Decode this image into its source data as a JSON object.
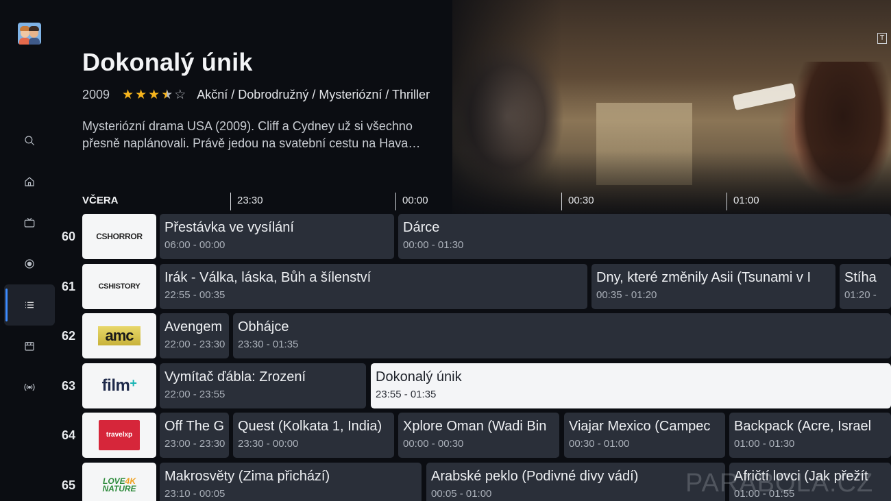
{
  "hero": {
    "title": "Dokonalý únik",
    "year": "2009",
    "rating": 3.5,
    "genres": "Akční / Dobrodružný / Mysteriózní / Thriller",
    "desc_line1": "Mysteriózní drama USA (2009). Cliff a Cydney už si všechno",
    "desc_line2": "přesně naplánovali. Právě jedou na svatební cestu na Hava…",
    "corner_badge": "T"
  },
  "sidebar": {
    "items": [
      {
        "icon": "search-icon"
      },
      {
        "icon": "home-icon"
      },
      {
        "icon": "tv-icon"
      },
      {
        "icon": "record-icon"
      },
      {
        "icon": "list-icon",
        "active": true
      },
      {
        "icon": "film-icon"
      },
      {
        "icon": "broadcast-icon"
      }
    ]
  },
  "timeline": {
    "day": "VČERA",
    "marks": [
      "23:30",
      "00:00",
      "00:30",
      "01:00"
    ]
  },
  "channels": [
    {
      "number": "60",
      "logo": "CSHORROR",
      "programs": [
        {
          "title": "Přestávka ve vysílání",
          "time": "06:00 - 00:00"
        },
        {
          "title": "Dárce",
          "time": "00:00 - 01:30"
        }
      ]
    },
    {
      "number": "61",
      "logo": "CSHISTORY",
      "programs": [
        {
          "title": "Irák - Válka, láska, Bůh a šílenství",
          "time": "22:55 - 00:35"
        },
        {
          "title": "Dny, které změnily Asii (Tsunami v I",
          "time": "00:35 - 01:20"
        },
        {
          "title": "Stíha",
          "time": "01:20 -"
        }
      ]
    },
    {
      "number": "62",
      "logo": "amc",
      "programs": [
        {
          "title": "Avengem",
          "time": "22:00 - 23:30"
        },
        {
          "title": "Obhájce",
          "time": "23:30 - 01:35"
        }
      ]
    },
    {
      "number": "63",
      "logo": "film",
      "programs": [
        {
          "title": "Vymítač ďábla: Zrození",
          "time": "22:00 - 23:55"
        },
        {
          "title": "Dokonalý únik",
          "time": "23:55 - 01:35",
          "selected": true
        }
      ]
    },
    {
      "number": "64",
      "logo": "travelxp",
      "programs": [
        {
          "title": "Off The G",
          "time": "23:00 - 23:30"
        },
        {
          "title": "Quest (Kolkata 1, India)",
          "time": "23:30 - 00:00"
        },
        {
          "title": "Xplore Oman (Wadi Bin",
          "time": "00:00 - 00:30"
        },
        {
          "title": "Viajar Mexico (Campec",
          "time": "00:30 - 01:00"
        },
        {
          "title": "Backpack (Acre, Israel",
          "time": "01:00 - 01:30"
        }
      ]
    },
    {
      "number": "65",
      "logo": "LOVE4K NATURE",
      "programs": [
        {
          "title": "Makrosvěty (Zima přichází)",
          "time": "23:10 - 00:05"
        },
        {
          "title": "Arabské peklo (Podivné divy vádí)",
          "time": "00:05 - 01:00"
        },
        {
          "title": "Afričtí lovci (Jak přežít",
          "time": "01:00 - 01:55"
        }
      ]
    }
  ],
  "logos": {
    "horror": "CSHORROR",
    "history": "CSHISTORY",
    "amc": "amc",
    "film": "film",
    "film_plus": "+",
    "travel": "travelxp",
    "love_line1": "LOVE",
    "love_k": "4K",
    "love_line2": "NATURE"
  },
  "watermark": "PARABOLA.CZ",
  "colors": {
    "accent": "#3d8bff",
    "star": "#f6b41d",
    "tile": "#2a2f39",
    "tile_selected": "#f4f5f7"
  }
}
